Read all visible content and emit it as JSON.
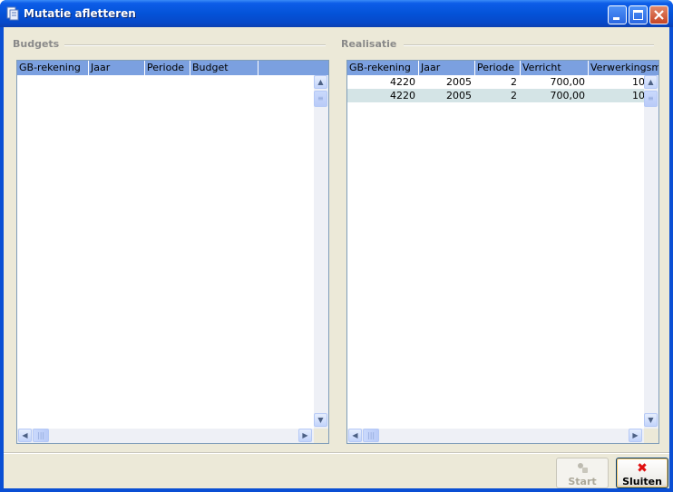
{
  "window": {
    "title": "Mutatie afletteren"
  },
  "budgets": {
    "title": "Budgets",
    "columns": [
      "GB-rekening",
      "Jaar",
      "Periode",
      "Budget",
      ""
    ],
    "rows": []
  },
  "realisatie": {
    "title": "Realisatie",
    "columns": [
      "GB-rekening",
      "Jaar",
      "Periode",
      "Verricht",
      "Verwerkingsm"
    ],
    "rows": [
      [
        "4220",
        "2005",
        "2",
        "700,00",
        "10"
      ],
      [
        "4220",
        "2005",
        "2",
        "700,00",
        "10"
      ]
    ]
  },
  "buttons": {
    "start": "Start",
    "close": "Sluiten"
  },
  "colors": {
    "titlebar": "#0453d8",
    "header": "#7ba0e0",
    "selected_row": "#d4e4e6",
    "close_icon": "#e01010"
  }
}
